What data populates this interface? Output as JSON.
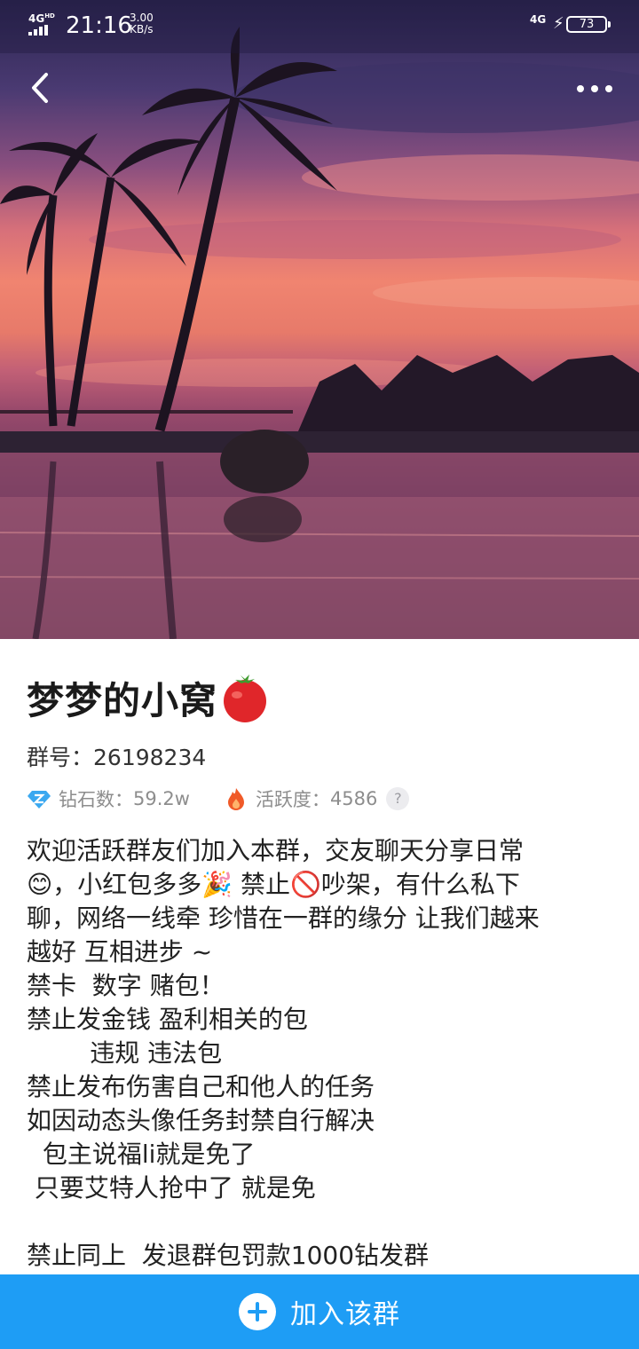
{
  "status_bar": {
    "network_left": "4G",
    "network_left_sup": "HD",
    "time": "21:16",
    "speed_value": "3.00",
    "speed_unit": "KB/s",
    "network_right": "4G",
    "battery": "73"
  },
  "nav": {
    "back_icon": "chevron-left-icon",
    "more_icon": "more-dots-icon"
  },
  "group": {
    "name": "梦梦的小窝",
    "name_emoji": "tomato-icon",
    "id_label": "群号：",
    "id_value": "26198234",
    "diamond_label": "钻石数：",
    "diamond_value": "59.2w",
    "activity_label": "活跃度：",
    "activity_value": "4586",
    "help_glyph": "?",
    "description_lines": [
      "欢迎活跃群友们加入本群，交友聊天分享日常",
      "😊，小红包多多🎉 禁止🚫吵架，有什么私下",
      "聊，网络一线牵 珍惜在一群的缘分 让我们越来",
      "越好 互相进步 ~",
      "禁卡  数字 赌包！",
      "禁止发金钱 盈利相关的包",
      "        违规 违法包",
      "禁止发布伤害自己和他人的任务",
      "如因动态头像任务封禁自行解决",
      "  包主说福li就是免了",
      " 只要艾特人抢中了 就是免",
      "",
      "禁止同上  发退群包罚款1000钻发群"
    ]
  },
  "join_button": {
    "label": "加入该群",
    "icon": "plus-circle-icon"
  },
  "colors": {
    "accent": "#1e9df5",
    "diamond": "#3aa8f0",
    "flame": "#f05a28",
    "muted_text": "#8d8d8d"
  }
}
